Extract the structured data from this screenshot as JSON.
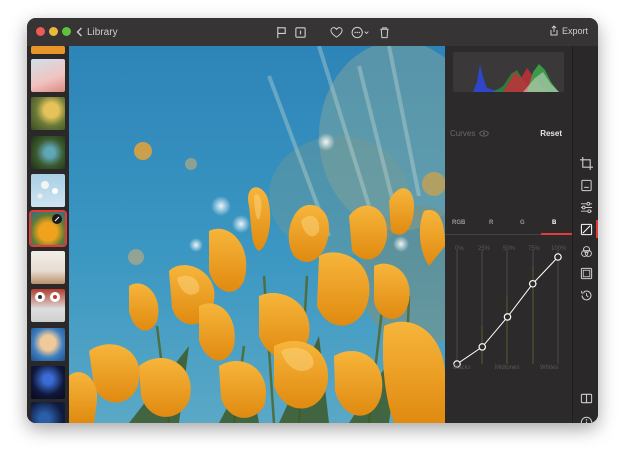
{
  "toolbar": {
    "back_label": "Library",
    "export_label": "Export",
    "icons": [
      "flag-icon",
      "info-card-icon",
      "heart-icon",
      "more-icon",
      "trash-icon"
    ]
  },
  "filmstrip": {
    "thumbnails": [
      "orange-strip",
      "tulips-pink",
      "bee-flower",
      "hummingbird",
      "balloons",
      "poppies-selected",
      "field",
      "people-icons",
      "boy-portrait",
      "jellyfish",
      "jellyfish-2",
      "city-night"
    ],
    "selected_index": 5
  },
  "panel": {
    "curves_label": "Curves",
    "reset_label": "Reset",
    "channels": [
      "RGB",
      "R",
      "G",
      "B"
    ],
    "active_channel": "B",
    "percent_labels": [
      "0%",
      "25%",
      "50%",
      "75%",
      "100%"
    ],
    "zone_labels": [
      "Blacks",
      "Midtones",
      "Whites"
    ],
    "curve_points": [
      [
        0,
        0
      ],
      [
        0.25,
        0.16
      ],
      [
        0.5,
        0.44
      ],
      [
        0.75,
        0.75
      ],
      [
        1,
        1
      ]
    ]
  },
  "tools": [
    "crop-icon",
    "adjust-icon",
    "sliders-icon",
    "curves-icon",
    "color-icon",
    "frame-icon",
    "history-icon",
    "compare-icon",
    "info-icon"
  ],
  "colors": {
    "accent": "#e13b3b",
    "window_bg": "#2a2828",
    "titlebar": "#363434"
  }
}
